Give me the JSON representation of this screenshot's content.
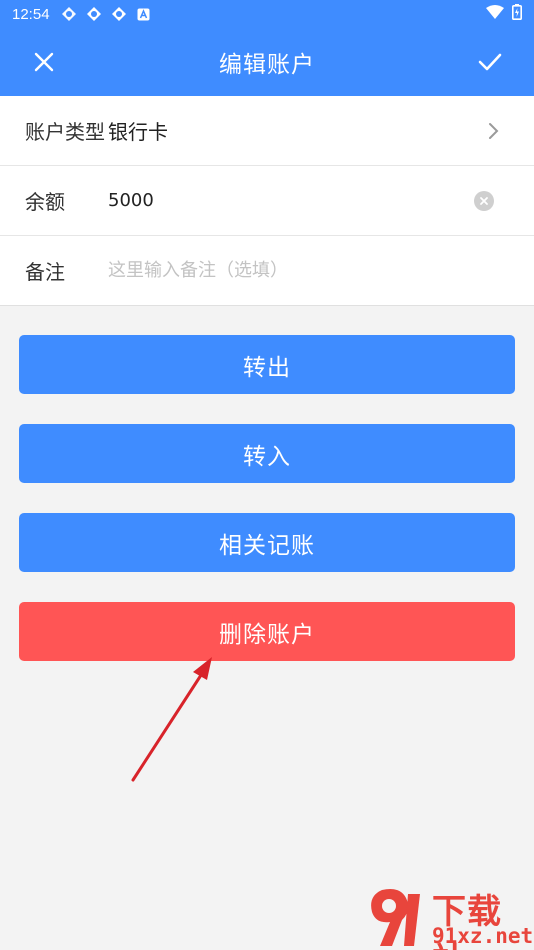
{
  "status_bar": {
    "time": "12:54"
  },
  "app_bar": {
    "title": "编辑账户"
  },
  "form": {
    "account_type": {
      "label": "账户类型",
      "value": "银行卡"
    },
    "balance": {
      "label": "余额",
      "value": "5000"
    },
    "note": {
      "label": "备注",
      "placeholder": "这里输入备注（选填）",
      "value": ""
    }
  },
  "buttons": {
    "transfer_out": "转出",
    "transfer_in": "转入",
    "related_records": "相关记账",
    "delete_account": "删除账户"
  },
  "watermark": {
    "line1": "下载站",
    "line2": "91xz.net"
  },
  "colors": {
    "primary": "#3f8cff",
    "danger": "#ff5555",
    "annotation": "#d8232a"
  }
}
